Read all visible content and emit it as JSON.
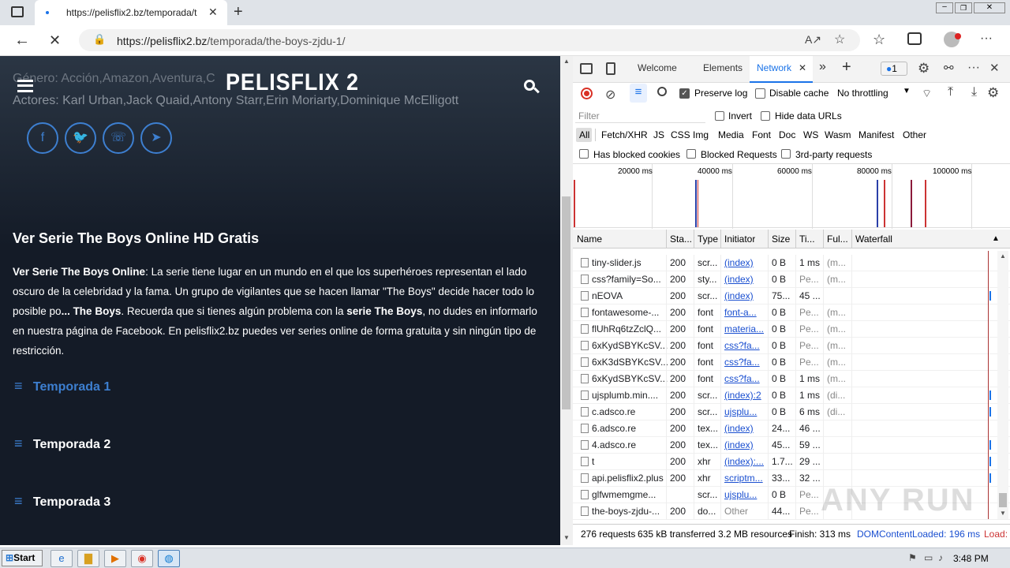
{
  "browser": {
    "tab_title": "https://pelisflix2.bz/temporada/t",
    "url_domain": "https://pelisflix2.bz",
    "url_path": "/temporada/the-boys-zjdu-1/"
  },
  "site": {
    "logo": "PELISFLIX 2",
    "genre": "Género: Acción,Amazon,Aventura,C",
    "actors": "Actores: Karl Urban,Jack Quaid,Antony Starr,Erin Moriarty,Dominique McElligott",
    "heading": "Ver Serie The Boys Online HD Gratis",
    "desc_bold1": "Ver Serie The Boys Online",
    "desc_text1": ": La serie tiene lugar en un mundo en el que los superhéroes representan el lado oscuro de la celebridad y la fama. Un grupo de vigilantes que se hacen llamar \"The Boys\" decide hacer todo lo posible po",
    "desc_bold2": "... The Boys",
    "desc_text2": ". Recuerda que si tienes algún problema con la ",
    "desc_bold3": "serie The Boys",
    "desc_text3": ", no dudes en informarlo en nuestra página de Facebook. En pelisflix2.bz puedes ver series online de forma gratuita y sin ningún tipo de restricción.",
    "seasons": [
      "Temporada 1",
      "Temporada 2",
      "Temporada 3"
    ]
  },
  "devtools": {
    "tabs": [
      "Welcome",
      "Elements",
      "Network"
    ],
    "issues_count": "1",
    "preserve_log": "Preserve log",
    "disable_cache": "Disable cache",
    "throttling": "No throttling",
    "filter_placeholder": "Filter",
    "invert": "Invert",
    "hide_data_urls": "Hide data URLs",
    "type_filters": [
      "All",
      "Fetch/XHR",
      "JS",
      "CSS",
      "Img",
      "Media",
      "Font",
      "Doc",
      "WS",
      "Wasm",
      "Manifest",
      "Other"
    ],
    "blocked_cookies": "Has blocked cookies",
    "blocked_requests": "Blocked Requests",
    "third_party": "3rd-party requests",
    "timeline_ticks": [
      "20000 ms",
      "40000 ms",
      "60000 ms",
      "80000 ms",
      "100000 ms"
    ],
    "columns": [
      "Name",
      "Sta...",
      "Type",
      "Initiator",
      "Size",
      "Ti...",
      "Ful...",
      "Waterfall"
    ],
    "rows": [
      {
        "name": "tiny-slider.js",
        "status": "200",
        "type": "scr...",
        "initiator": "(index)",
        "size": "0 B",
        "time": "1 ms",
        "full": "(m..."
      },
      {
        "name": "css?family=So...",
        "status": "200",
        "type": "sty...",
        "initiator": "(index)",
        "size": "0 B",
        "time": "Pe...",
        "full": "(m..."
      },
      {
        "name": "nEOVA",
        "status": "200",
        "type": "scr...",
        "initiator": "(index)",
        "size": "75...",
        "time": "45 ...",
        "full": ""
      },
      {
        "name": "fontawesome-...",
        "status": "200",
        "type": "font",
        "initiator": "font-a...",
        "size": "0 B",
        "time": "Pe...",
        "full": "(m..."
      },
      {
        "name": "flUhRq6tzZclQ...",
        "status": "200",
        "type": "font",
        "initiator": "materia...",
        "size": "0 B",
        "time": "Pe...",
        "full": "(m..."
      },
      {
        "name": "6xKydSBYKcSV...",
        "status": "200",
        "type": "font",
        "initiator": "css?fa...",
        "size": "0 B",
        "time": "Pe...",
        "full": "(m..."
      },
      {
        "name": "6xK3dSBYKcSV...",
        "status": "200",
        "type": "font",
        "initiator": "css?fa...",
        "size": "0 B",
        "time": "Pe...",
        "full": "(m..."
      },
      {
        "name": "6xKydSBYKcSV...",
        "status": "200",
        "type": "font",
        "initiator": "css?fa...",
        "size": "0 B",
        "time": "1 ms",
        "full": "(m..."
      },
      {
        "name": "ujsplumb.min....",
        "status": "200",
        "type": "scr...",
        "initiator": "(index):2",
        "size": "0 B",
        "time": "1 ms",
        "full": "(di..."
      },
      {
        "name": "c.adsco.re",
        "status": "200",
        "type": "scr...",
        "initiator": "ujsplu...",
        "size": "0 B",
        "time": "6 ms",
        "full": "(di..."
      },
      {
        "name": "6.adsco.re",
        "status": "200",
        "type": "tex...",
        "initiator": "(index)",
        "size": "24...",
        "time": "46 ...",
        "full": ""
      },
      {
        "name": "4.adsco.re",
        "status": "200",
        "type": "tex...",
        "initiator": "(index)",
        "size": "45...",
        "time": "59 ...",
        "full": ""
      },
      {
        "name": "t",
        "status": "200",
        "type": "xhr",
        "initiator": "(index):...",
        "size": "1.7...",
        "time": "29 ...",
        "full": ""
      },
      {
        "name": "api.pelisflix2.plus",
        "status": "200",
        "type": "xhr",
        "initiator": "scriptm...",
        "size": "33...",
        "time": "32 ...",
        "full": ""
      },
      {
        "name": "glfwmemgme...",
        "status": "",
        "type": "scr...",
        "initiator": "ujsplu...",
        "size": "0 B",
        "time": "Pe...",
        "full": ""
      },
      {
        "name": "the-boys-zjdu-...",
        "status": "200",
        "type": "do...",
        "initiator": "Other",
        "size": "44...",
        "time": "Pe...",
        "full": ""
      }
    ],
    "status_requests": "276 requests",
    "status_transferred": "635 kB transferred",
    "status_resources": "3.2 MB resources",
    "status_finish": "Finish: 313 ms",
    "status_dcl": "DOMContentLoaded: 196 ms",
    "status_load": "Load:"
  },
  "taskbar": {
    "start": "Start",
    "time": "3:48 PM"
  },
  "watermark": "ANY RUN"
}
